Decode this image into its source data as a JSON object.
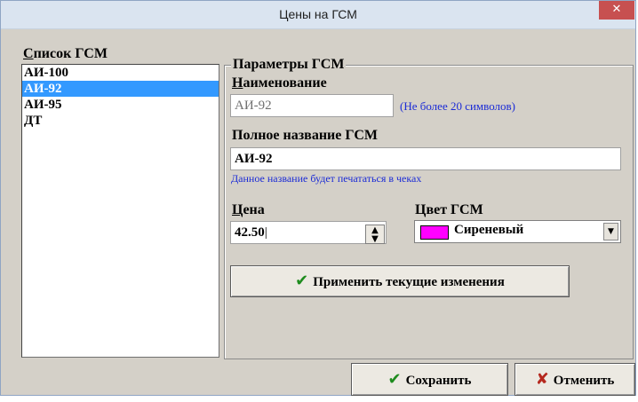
{
  "window": {
    "title": "Цены на  ГСМ",
    "close_symbol": "✕"
  },
  "list": {
    "label_hotkey": "С",
    "label_rest": "писок ГСМ",
    "items": [
      "АИ-100",
      "АИ-92",
      "АИ-95",
      "ДТ"
    ],
    "selected_index": 1
  },
  "params": {
    "group_title": "Параметры ГСМ",
    "name_label_hotkey": "Н",
    "name_label_rest": "аименование",
    "name_value": "АИ-92",
    "name_hint": "(Не более 20 символов)",
    "full_name_label": "Полное название ГСМ",
    "full_name_value": "АИ-92",
    "full_name_hint": "Данное название будет печататься в чеках",
    "price_label_hotkey": "Ц",
    "price_label_rest": "ена",
    "price_value": "42.50",
    "color_label": "Цвет ГСМ",
    "color_value": "Сиреневый",
    "color_swatch": "#ff00ff",
    "apply_label": "Применить текущие изменения"
  },
  "footer": {
    "save_label": "Сохранить",
    "cancel_label": "Отменить"
  },
  "icons": {
    "check": "check-icon",
    "cross": "cross-icon",
    "spin": "spin-arrows-icon",
    "dropdown": "chevron-down-icon"
  },
  "colors": {
    "selection": "#3399ff",
    "hint": "#1b2bd6",
    "close": "#c75050"
  }
}
